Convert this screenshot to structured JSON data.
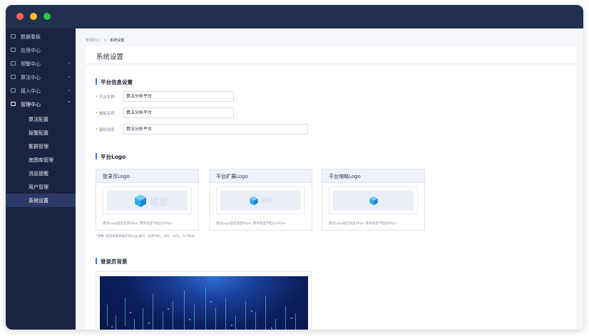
{
  "sidebar": {
    "items": [
      {
        "label": "数据看板",
        "has_chevron": false
      },
      {
        "label": "应用中心",
        "has_chevron": false
      },
      {
        "label": "预警中心",
        "has_chevron": true,
        "chevron": "⌄"
      },
      {
        "label": "算法中心",
        "has_chevron": true,
        "chevron": "⌄"
      },
      {
        "label": "接入中心",
        "has_chevron": true,
        "chevron": "⌄"
      },
      {
        "label": "管理中心",
        "has_chevron": true,
        "chevron": "⌃",
        "expanded": true
      }
    ],
    "sub_items": [
      {
        "label": "算法配置"
      },
      {
        "label": "报警配置"
      },
      {
        "label": "集群管理"
      },
      {
        "label": "底图库管理"
      },
      {
        "label": "消息提醒"
      },
      {
        "label": "用户管理"
      },
      {
        "label": "系统设置",
        "active": true
      }
    ]
  },
  "breadcrumb": {
    "parent": "管理中心",
    "separator": ">",
    "current": "系统设置"
  },
  "page": {
    "title": "系统设置"
  },
  "platform_info": {
    "section_title": "平台信息设置",
    "fields": [
      {
        "label": "平台名称",
        "required_mark": "*",
        "value": "算法分析平台"
      },
      {
        "label": "看板名称",
        "required_mark": "*",
        "value": "算法分析平台"
      },
      {
        "label": "版权信息",
        "required_mark": "*",
        "value": "算法分析平台"
      }
    ]
  },
  "platform_logo": {
    "section_title": "平台Logo",
    "cards": [
      {
        "title": "登录页Logo",
        "logo_text": "磁星",
        "hint": "建议Logo固定高度60px, 整体宽度不超过200px"
      },
      {
        "title": "平台扩展Logo",
        "logo_text": "磁星",
        "hint": "建议Logo固定高度40px, 整体宽度不超过160px"
      },
      {
        "title": "平台缩略Logo",
        "logo_text": "",
        "hint": "建议Logo固定高度40px, 整体宽度不超过60px"
      }
    ],
    "note": "*注释: 请选择需要展示的Logo图片, 支持PNG、JPG、SVG、GIF格式。"
  },
  "login_background": {
    "section_title": "登录页背景"
  },
  "colors": {
    "accent": "#2f7ff0",
    "sidebar_bg": "#1b2340",
    "titlebar_bg": "#23304d",
    "sidebar_active": "#2b3a66",
    "logo_cube": "#3bb6f0"
  }
}
